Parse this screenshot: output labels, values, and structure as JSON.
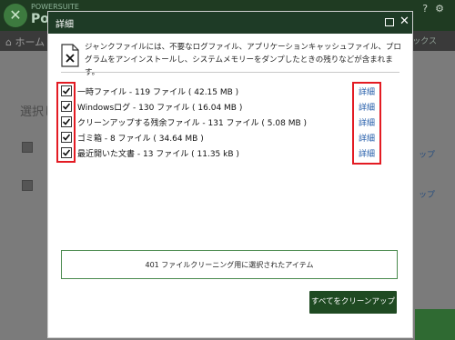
{
  "background": {
    "brand_small": "POWERSUITE",
    "brand_large": "Po",
    "home_label": "ホーム",
    "tools_label": "ックス",
    "selection_label": "選択し",
    "side_link_1": "ップ",
    "side_link_2": "ップ"
  },
  "dialog": {
    "title": "詳細",
    "description": "ジャンクファイルには、不要なログファイル、アプリケーションキャッシュファイル、プログラムをアンインストールし、システムメモリーをダンプしたときの残りなどが含まれます。",
    "items": [
      {
        "label": "一時ファイル - 119 ファイル ( 42.15 MB )",
        "checked": true,
        "link": "詳細"
      },
      {
        "label": "Windowsログ - 130 ファイル ( 16.04 MB )",
        "checked": true,
        "link": "詳細"
      },
      {
        "label": "クリーンアップする残余ファイル - 131 ファイル ( 5.08 MB )",
        "checked": true,
        "link": "詳細"
      },
      {
        "label": "ゴミ箱 - 8 ファイル ( 34.64 MB )",
        "checked": true,
        "link": "詳細"
      },
      {
        "label": "最近開いた文書 - 13 ファイル ( 11.35 kB )",
        "checked": true,
        "link": "詳細"
      }
    ],
    "summary": "401 ファイルクリーニング用に選択されたアイテム",
    "cleanup_button": "すべてをクリーンアップ"
  },
  "colors": {
    "header": "#1e3b26",
    "button": "#1f4a22",
    "highlight": "#e31b23",
    "link": "#1f5aa8"
  }
}
